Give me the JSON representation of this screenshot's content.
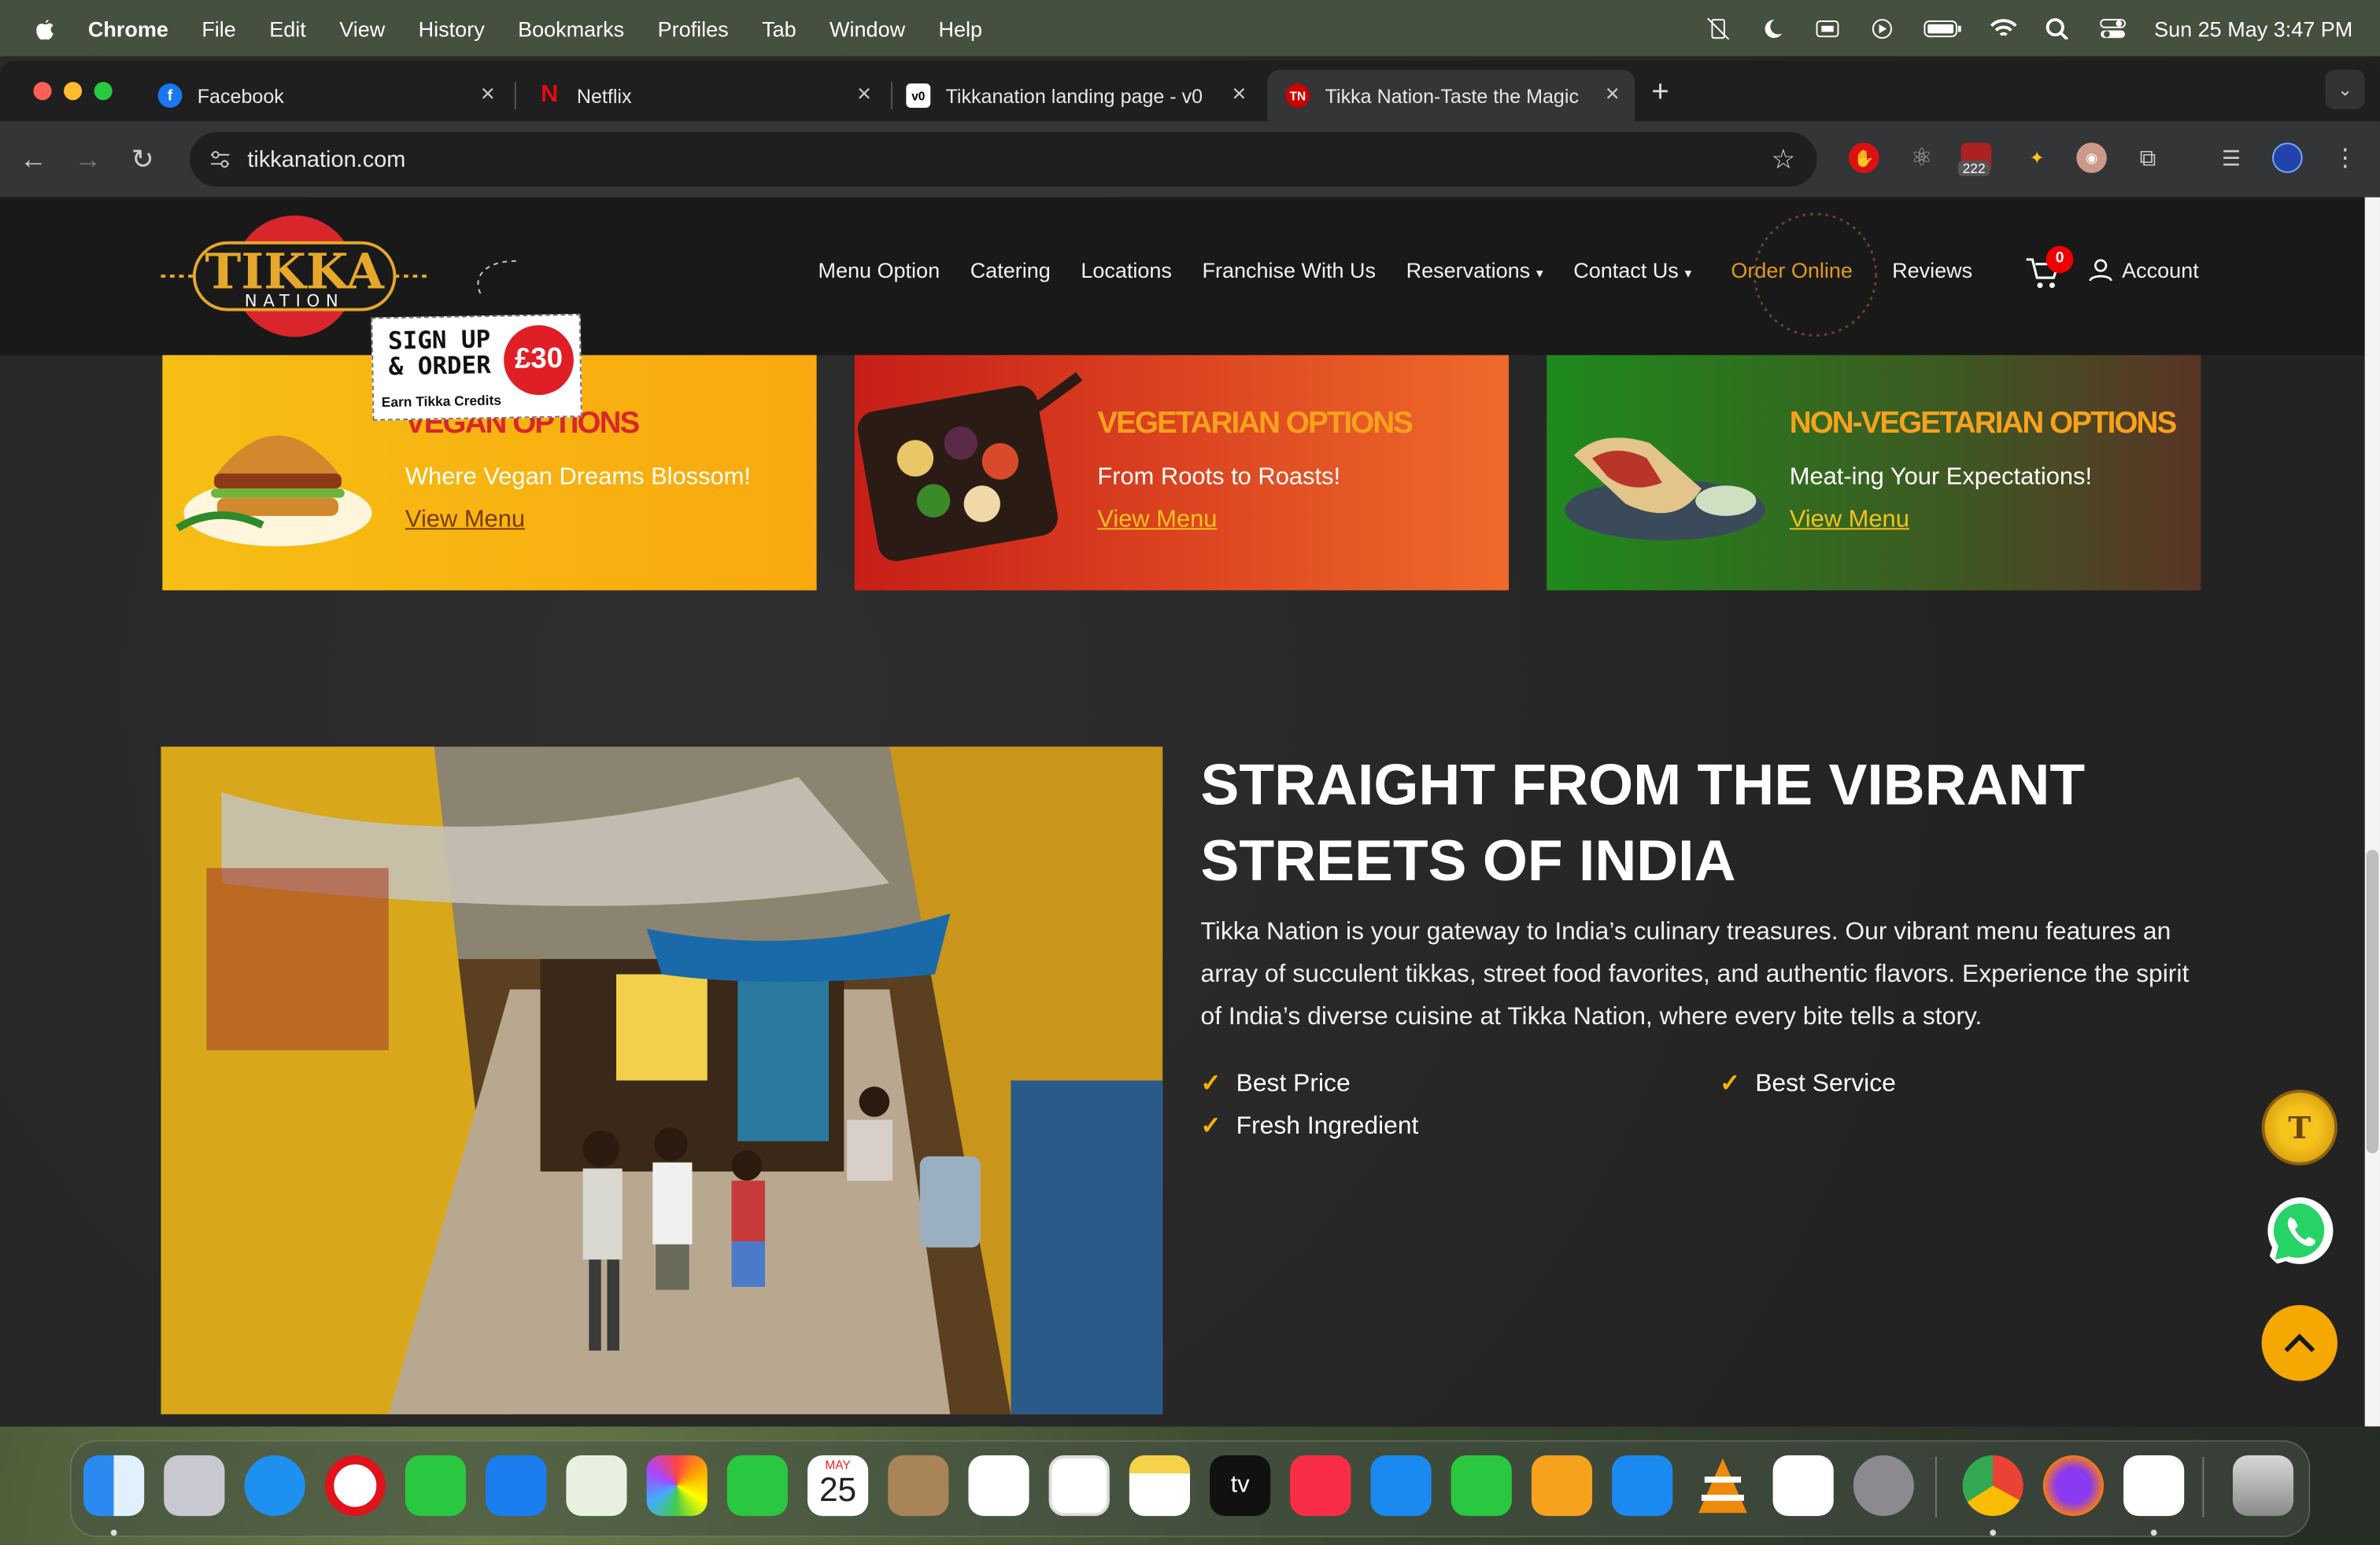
{
  "menubar": {
    "app": "Chrome",
    "items": [
      "File",
      "Edit",
      "View",
      "History",
      "Bookmarks",
      "Profiles",
      "Tab",
      "Window",
      "Help"
    ],
    "datetime": "Sun 25 May  3:47 PM"
  },
  "tabs": [
    {
      "title": "Facebook"
    },
    {
      "title": "Netflix"
    },
    {
      "title": "Tikkanation landing page - v0"
    },
    {
      "title": "Tikka Nation-Taste the Magic"
    }
  ],
  "address": {
    "url": "tikkanation.com"
  },
  "extensions": {
    "badge_count": "222"
  },
  "site": {
    "logo": {
      "top": "TIKKA",
      "bottom": "NATION"
    },
    "promo": {
      "line1": "SIGN UP",
      "line2": "& ORDER",
      "amount": "£30",
      "line3": "Earn Tikka Credits"
    },
    "nav": [
      "Menu Option",
      "Catering",
      "Locations",
      "Franchise With Us",
      "Reservations",
      "Contact Us",
      "Order Online",
      "Reviews"
    ],
    "cart_count": "0",
    "account": "Account"
  },
  "cards": [
    {
      "title": "VEGAN OPTIONS",
      "subtitle": "Where Vegan Dreams Blossom!",
      "link": "View Menu",
      "color": "#f5b400"
    },
    {
      "title": "VEGETARIAN OPTIONS",
      "subtitle": "From Roots to Roasts!",
      "link": "View Menu",
      "color": "#e24a14"
    },
    {
      "title": "NON-VEGETARIAN OPTIONS",
      "subtitle": "Meat-ing Your Expectations!",
      "link": "View Menu",
      "color": "#2e8b1e"
    }
  ],
  "about": {
    "heading_line1": "STRAIGHT FROM THE VIBRANT",
    "heading_line2": "STREETS OF INDIA",
    "paragraph": "Tikka Nation is your gateway to India’s culinary treasures. Our vibrant menu features an array of succulent tikkas, street food favorites, and authentic flavors. Experience the spirit of India’s diverse cuisine at Tikka Nation, where every bite tells a story.",
    "features": [
      "Best Price",
      "Best Service",
      "Fresh Ingredient"
    ]
  },
  "floating": {
    "credits_letter": "T"
  },
  "dock": {
    "calendar_month": "MAY",
    "calendar_day": "25",
    "tv_label": "tv"
  },
  "colors": {
    "accent": "#f5b400",
    "order_online": "#e39a1a",
    "header_bg": "#191919"
  }
}
